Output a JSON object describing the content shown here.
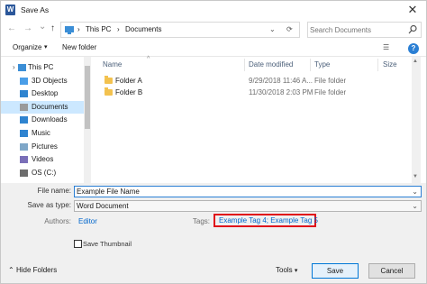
{
  "window": {
    "title": "Save As",
    "app_icon": "W",
    "close_glyph": "✕"
  },
  "address": {
    "back_glyph": "←",
    "forward_glyph": "→",
    "recent_glyph": "⌄",
    "up_glyph": "↑",
    "crumbs": [
      "This PC",
      "Documents"
    ],
    "separator": "›",
    "dropdown_glyph": "⌄",
    "refresh_glyph": "⟳",
    "search_placeholder": "Search Documents"
  },
  "toolbar": {
    "organize_label": "Organize",
    "organize_arrow": "▾",
    "new_folder_label": "New folder",
    "view_glyph": "☰",
    "help_glyph": "?"
  },
  "nav": {
    "items": [
      {
        "label": "This PC",
        "icon": "pc-icon",
        "color": "#3b8ed6"
      },
      {
        "label": "3D Objects",
        "icon": "cube-icon",
        "color": "#4a9ee8"
      },
      {
        "label": "Desktop",
        "icon": "desktop-icon",
        "color": "#2f84d0"
      },
      {
        "label": "Documents",
        "icon": "documents-icon",
        "color": "#9a9a9a"
      },
      {
        "label": "Downloads",
        "icon": "download-icon",
        "color": "#2f84d0"
      },
      {
        "label": "Music",
        "icon": "music-icon",
        "color": "#2f84d0"
      },
      {
        "label": "Pictures",
        "icon": "pictures-icon",
        "color": "#7fa7c8"
      },
      {
        "label": "Videos",
        "icon": "videos-icon",
        "color": "#7a6fb8"
      },
      {
        "label": "OS (C:)",
        "icon": "drive-icon",
        "color": "#6d6d6d"
      }
    ],
    "selected": "Documents"
  },
  "files": {
    "columns": [
      "Name",
      "Date modified",
      "Type",
      "Size"
    ],
    "sort_glyph": "^",
    "rows": [
      {
        "name": "Folder A",
        "date": "9/29/2018 11:46 A...",
        "type": "File folder"
      },
      {
        "name": "Folder B",
        "date": "11/30/2018 2:03 PM",
        "type": "File folder"
      }
    ],
    "scroll_up": "▲",
    "scroll_down": "▼"
  },
  "form": {
    "file_name_label": "File name:",
    "file_name_value": "Example File Name",
    "save_type_label": "Save as type:",
    "save_type_value": "Word Document",
    "authors_label": "Authors:",
    "authors_value": "Editor",
    "tags_label": "Tags:",
    "tags_value": "Example Tag 4; Example Tag 5",
    "thumbnail_label": "Save Thumbnail",
    "dropdown_glyph": "⌄"
  },
  "footer": {
    "hide_folders_glyph": "⌃",
    "hide_folders_label": "Hide Folders",
    "tools_label": "Tools",
    "tools_arrow": "▾",
    "save_label": "Save",
    "cancel_label": "Cancel"
  },
  "colors": {
    "selection": "#cce8ff",
    "highlight_border": "#e0101a",
    "link": "#0066cc",
    "folder": "#f3c24f"
  }
}
